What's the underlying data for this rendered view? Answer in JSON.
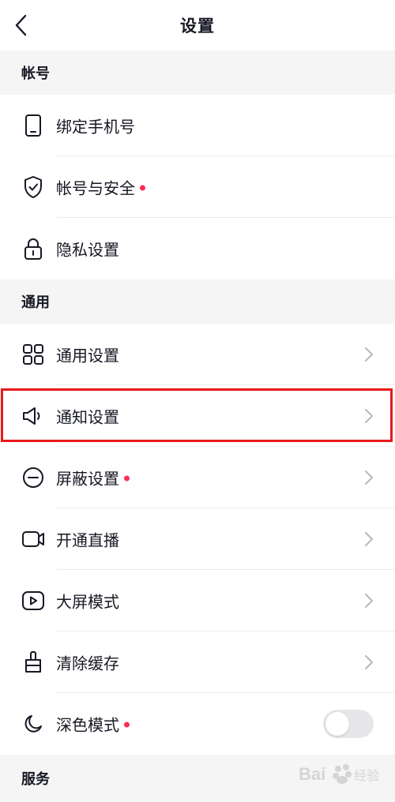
{
  "header": {
    "title": "设置"
  },
  "sections": {
    "account": {
      "title": "帐号",
      "items": [
        {
          "label": "绑定手机号",
          "icon": "phone-icon"
        },
        {
          "label": "帐号与安全",
          "icon": "shield-check-icon",
          "dot": true
        },
        {
          "label": "隐私设置",
          "icon": "lock-icon"
        }
      ]
    },
    "general": {
      "title": "通用",
      "items": [
        {
          "label": "通用设置",
          "icon": "grid-icon"
        },
        {
          "label": "通知设置",
          "icon": "speaker-icon",
          "highlighted": true
        },
        {
          "label": "屏蔽设置",
          "icon": "minus-circle-icon",
          "dot": true
        },
        {
          "label": "开通直播",
          "icon": "video-camera-icon"
        },
        {
          "label": "大屏模式",
          "icon": "play-screen-icon"
        },
        {
          "label": "清除缓存",
          "icon": "broom-icon"
        },
        {
          "label": "深色模式",
          "icon": "moon-icon",
          "dot": true,
          "toggle_on": false
        }
      ]
    },
    "service": {
      "title": "服务"
    }
  },
  "colors": {
    "accent_dot": "#fe2c55",
    "highlight_border": "#e8191b"
  },
  "watermark": {
    "text": "Bai 经验"
  }
}
